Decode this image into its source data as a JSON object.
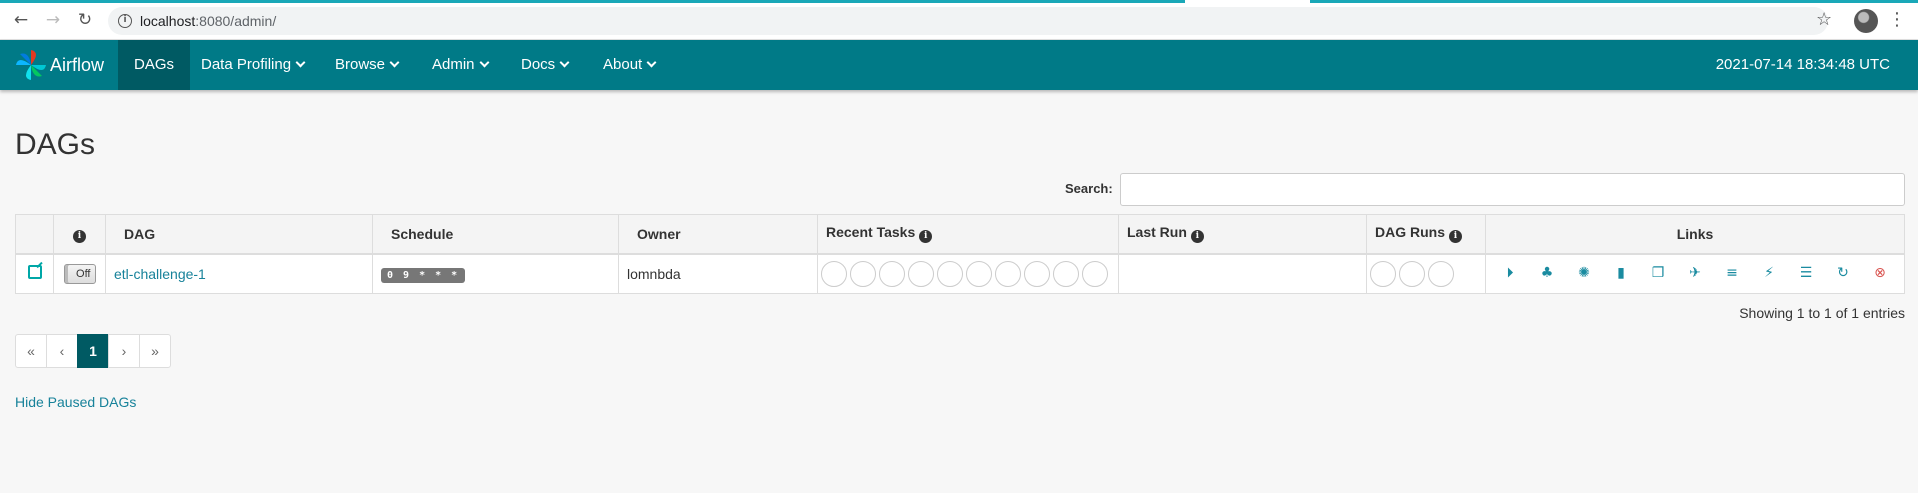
{
  "browser": {
    "url_host": "localhost",
    "url_path": ":8080/admin/"
  },
  "navbar": {
    "brand": "Airflow",
    "items": [
      {
        "label": "DAGs",
        "active": true,
        "caret": false
      },
      {
        "label": "Data Profiling",
        "active": false,
        "caret": true
      },
      {
        "label": "Browse",
        "active": false,
        "caret": true
      },
      {
        "label": "Admin",
        "active": false,
        "caret": true
      },
      {
        "label": "Docs",
        "active": false,
        "caret": true
      },
      {
        "label": "About",
        "active": false,
        "caret": true
      }
    ],
    "clock": "2021-07-14 18:34:48 UTC"
  },
  "page": {
    "title": "DAGs",
    "search_label": "Search:",
    "search_value": ""
  },
  "table": {
    "headers": {
      "dag": "DAG",
      "schedule": "Schedule",
      "owner": "Owner",
      "recent_tasks": "Recent Tasks",
      "last_run": "Last Run",
      "dag_runs": "DAG Runs",
      "links": "Links"
    },
    "rows": [
      {
        "toggle": "Off",
        "dag": "etl-challenge-1",
        "schedule": "0 9 * * *",
        "owner": "lomnbda",
        "last_run": "",
        "recent_task_slots": 10,
        "dag_run_slots": 3
      }
    ],
    "link_icons": [
      "trigger-dag-icon",
      "tree-view-icon",
      "graph-view-icon",
      "task-duration-icon",
      "task-tries-icon",
      "landing-times-icon",
      "gantt-icon",
      "code-view-icon",
      "logs-icon",
      "refresh-icon",
      "delete-dag-icon"
    ]
  },
  "footer": {
    "showing": "Showing 1 to 1 of 1 entries",
    "pagination": [
      "«",
      "‹",
      "1",
      "›",
      "»"
    ],
    "active_page": "1",
    "hide_paused": "Hide Paused DAGs"
  },
  "colors": {
    "navbar": "#007a87",
    "navbar_active": "#005a63",
    "link": "#17829a",
    "danger": "#d9534f"
  }
}
